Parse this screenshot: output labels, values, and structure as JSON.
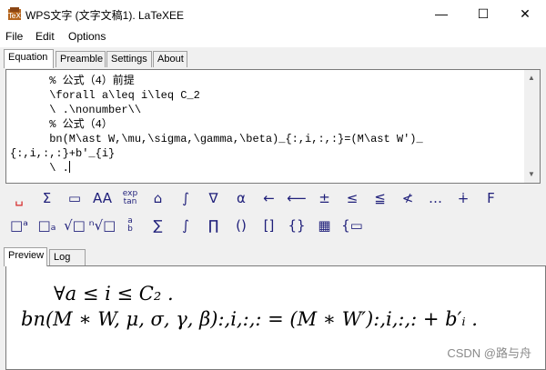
{
  "window": {
    "title": "WPS文字 (文字文稿1). LaTeXEE",
    "controls": {
      "minimize": "—",
      "maximize": "☐",
      "close": "✕"
    }
  },
  "menu": [
    "File",
    "Edit",
    "Options"
  ],
  "editor_tabs": [
    {
      "label": "Equation",
      "active": true
    },
    {
      "label": "Preamble",
      "active": false
    },
    {
      "label": "Settings",
      "active": false
    },
    {
      "label": "About",
      "active": false
    }
  ],
  "editor": {
    "lines": [
      "      % 公式（4）前提",
      "      \\forall a\\leq i\\leq C_2",
      "      \\ .\\nonumber\\\\",
      "      % 公式（4）",
      "      bn(M\\ast W,\\mu,\\sigma,\\gamma,\\beta)_{:,i,:,:}=(M\\ast W')_",
      "{:,i,:,:}+b'_{i}",
      "      \\ ."
    ]
  },
  "symbol_toolbar": {
    "row1": [
      "space-icon",
      "sum-sub-icon",
      "frac-stack-icon",
      "font-style-icon",
      "exp-tan-icon",
      "accent-box-icon",
      "integral-box-icon",
      "nabla-icon",
      "alpha-icon",
      "left-arrow-icon",
      "long-left-arrow-icon",
      "plus-minus-icon",
      "leq-icon",
      "leqq-icon",
      "not-less-icon",
      "ellipsis-icon",
      "dagger-icon",
      "font-f-icon"
    ],
    "row1_glyphs": [
      "␣",
      "Σ",
      "▭",
      "AA",
      "exp\ntan",
      "⌂",
      "∫",
      "∇",
      "α",
      "←",
      "⟵",
      "±",
      "≤",
      "≦",
      "≮",
      "…",
      "∔",
      "F"
    ],
    "row2": [
      "superscript-icon",
      "subscript-icon",
      "sqrt-icon",
      "nth-root-icon",
      "fraction-icon",
      "sum-icon",
      "integral-icon",
      "product-icon",
      "parentheses-icon",
      "brackets-icon",
      "braces-icon",
      "matrix-icon",
      "cases-icon"
    ],
    "row2_glyphs": [
      "□ᵃ",
      "□ₐ",
      "√□",
      "ⁿ√□",
      "a\nb",
      "∑",
      "∫",
      "∏",
      "()",
      "[]",
      "{}",
      "▦",
      "{▭"
    ]
  },
  "output_tabs": [
    {
      "label": "Preview",
      "active": true
    },
    {
      "label": "Log",
      "active": false
    }
  ],
  "preview": {
    "line1": "∀a ≤ i ≤ C₂ .",
    "line2": "bn(M ∗ W, μ, σ, γ, β):,i,:,: = (M ∗ W′):,i,:,: + b′ᵢ ."
  },
  "watermark": "CSDN @路与舟",
  "colors": {
    "toolbar_red": "#d62828",
    "toolbar_blue": "#1f1f7a"
  }
}
